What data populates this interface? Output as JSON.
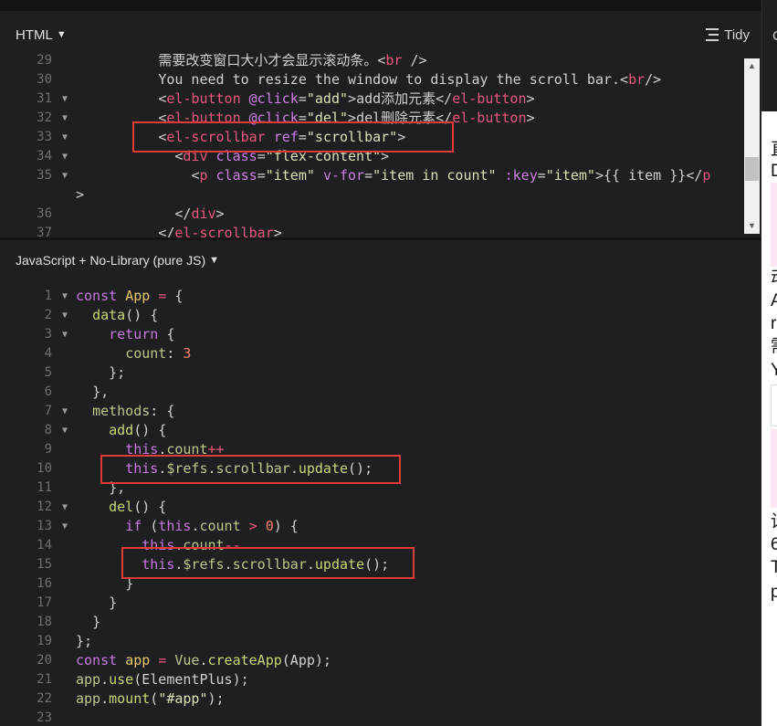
{
  "html_panel": {
    "lang_label": "HTML",
    "tidy_label": "Tidy",
    "lines": [
      {
        "n": "29",
        "fold": false,
        "indent": "          ",
        "tokens": [
          [
            "t",
            "需要改变窗口大小才会显示滚动条。"
          ],
          [
            "p",
            "<"
          ],
          [
            "tag",
            "br"
          ],
          [
            "p",
            " />"
          ]
        ]
      },
      {
        "n": "30",
        "fold": false,
        "indent": "          ",
        "tokens": [
          [
            "t",
            "You need to resize the window to display the scroll bar."
          ],
          [
            "p",
            "<"
          ],
          [
            "tag",
            "br"
          ],
          [
            "p",
            "/>"
          ]
        ]
      },
      {
        "n": "31",
        "fold": true,
        "indent": "          ",
        "tokens": [
          [
            "p",
            "<"
          ],
          [
            "tag",
            "el-button"
          ],
          [
            "t",
            " "
          ],
          [
            "attr",
            "@click"
          ],
          [
            "p",
            "="
          ],
          [
            "str",
            "\"add\""
          ],
          [
            "p",
            ">"
          ],
          [
            "t",
            "add添加元素"
          ],
          [
            "p",
            "</"
          ],
          [
            "tag",
            "el-button"
          ],
          [
            "p",
            ">"
          ]
        ]
      },
      {
        "n": "32",
        "fold": true,
        "indent": "          ",
        "tokens": [
          [
            "p",
            "<"
          ],
          [
            "tag",
            "el-button"
          ],
          [
            "t",
            " "
          ],
          [
            "attr",
            "@click"
          ],
          [
            "p",
            "="
          ],
          [
            "str",
            "\"del\""
          ],
          [
            "p",
            ">"
          ],
          [
            "t",
            "del删除元素"
          ],
          [
            "p",
            "</"
          ],
          [
            "tag",
            "el-button"
          ],
          [
            "p",
            ">"
          ]
        ]
      },
      {
        "n": "33",
        "fold": true,
        "indent": "          ",
        "tokens": [
          [
            "p",
            "<"
          ],
          [
            "tag",
            "el-scrollbar"
          ],
          [
            "t",
            " "
          ],
          [
            "attr",
            "ref"
          ],
          [
            "p",
            "="
          ],
          [
            "str",
            "\"scrollbar\""
          ],
          [
            "p",
            ">"
          ]
        ]
      },
      {
        "n": "34",
        "fold": true,
        "indent": "            ",
        "tokens": [
          [
            "p",
            "<"
          ],
          [
            "tag",
            "div"
          ],
          [
            "t",
            " "
          ],
          [
            "attr",
            "class"
          ],
          [
            "p",
            "="
          ],
          [
            "str",
            "\"flex-content\""
          ],
          [
            "p",
            ">"
          ]
        ]
      },
      {
        "n": "35",
        "fold": true,
        "indent": "              ",
        "tokens": [
          [
            "p",
            "<"
          ],
          [
            "tag",
            "p"
          ],
          [
            "t",
            " "
          ],
          [
            "attr",
            "class"
          ],
          [
            "p",
            "="
          ],
          [
            "str",
            "\"item\""
          ],
          [
            "t",
            " "
          ],
          [
            "attr",
            "v-for"
          ],
          [
            "p",
            "="
          ],
          [
            "str",
            "\"item in count\""
          ],
          [
            "t",
            " "
          ],
          [
            "attr",
            ":key"
          ],
          [
            "p",
            "="
          ],
          [
            "str",
            "\"item\""
          ],
          [
            "p",
            ">"
          ],
          [
            "t",
            "{{ item }}"
          ],
          [
            "p",
            "</"
          ],
          [
            "tag",
            "p"
          ]
        ]
      },
      {
        "n": "",
        "fold": false,
        "indent": "",
        "tokens": [
          [
            "p",
            ">"
          ]
        ]
      },
      {
        "n": "36",
        "fold": false,
        "indent": "            ",
        "tokens": [
          [
            "p",
            "</"
          ],
          [
            "tag",
            "div"
          ],
          [
            "p",
            ">"
          ]
        ]
      },
      {
        "n": "37",
        "fold": false,
        "indent": "          ",
        "tokens": [
          [
            "p",
            "</"
          ],
          [
            "tag",
            "el-scrollbar"
          ],
          [
            "p",
            ">"
          ]
        ]
      }
    ]
  },
  "js_panel": {
    "lang_label": "JavaScript + No-Library (pure JS)",
    "lines": [
      {
        "n": "1",
        "fold": true,
        "indent": "",
        "tokens": [
          [
            "kw",
            "const"
          ],
          [
            "t",
            " "
          ],
          [
            "var",
            "App"
          ],
          [
            "t",
            " "
          ],
          [
            "tag",
            "="
          ],
          [
            "t",
            " {"
          ]
        ]
      },
      {
        "n": "2",
        "fold": true,
        "indent": "  ",
        "tokens": [
          [
            "fn",
            "data"
          ],
          [
            "t",
            "() {"
          ]
        ]
      },
      {
        "n": "3",
        "fold": true,
        "indent": "    ",
        "tokens": [
          [
            "kw",
            "return"
          ],
          [
            "t",
            " {"
          ]
        ]
      },
      {
        "n": "4",
        "fold": false,
        "indent": "      ",
        "tokens": [
          [
            "prop",
            "count"
          ],
          [
            "t",
            ": "
          ],
          [
            "num",
            "3"
          ]
        ]
      },
      {
        "n": "5",
        "fold": false,
        "indent": "    ",
        "tokens": [
          [
            "t",
            "};"
          ]
        ]
      },
      {
        "n": "6",
        "fold": false,
        "indent": "  ",
        "tokens": [
          [
            "t",
            "},"
          ]
        ]
      },
      {
        "n": "7",
        "fold": true,
        "indent": "  ",
        "tokens": [
          [
            "prop",
            "methods"
          ],
          [
            "t",
            ": {"
          ]
        ]
      },
      {
        "n": "8",
        "fold": true,
        "indent": "    ",
        "tokens": [
          [
            "fn",
            "add"
          ],
          [
            "t",
            "() {"
          ]
        ]
      },
      {
        "n": "9",
        "fold": false,
        "indent": "      ",
        "tokens": [
          [
            "kw",
            "this"
          ],
          [
            "t",
            "."
          ],
          [
            "prop",
            "count"
          ],
          [
            "tag",
            "++"
          ]
        ]
      },
      {
        "n": "10",
        "fold": false,
        "indent": "      ",
        "tokens": [
          [
            "kw",
            "this"
          ],
          [
            "t",
            "."
          ],
          [
            "prop",
            "$refs"
          ],
          [
            "t",
            "."
          ],
          [
            "prop",
            "scrollbar"
          ],
          [
            "t",
            "."
          ],
          [
            "fn",
            "update"
          ],
          [
            "t",
            "();"
          ]
        ]
      },
      {
        "n": "11",
        "fold": false,
        "indent": "    ",
        "tokens": [
          [
            "t",
            "},"
          ]
        ]
      },
      {
        "n": "12",
        "fold": true,
        "indent": "    ",
        "tokens": [
          [
            "fn",
            "del"
          ],
          [
            "t",
            "() {"
          ]
        ]
      },
      {
        "n": "13",
        "fold": true,
        "indent": "      ",
        "tokens": [
          [
            "kw",
            "if"
          ],
          [
            "t",
            " ("
          ],
          [
            "kw",
            "this"
          ],
          [
            "t",
            "."
          ],
          [
            "prop",
            "count"
          ],
          [
            "t",
            " "
          ],
          [
            "tag",
            ">"
          ],
          [
            "t",
            " "
          ],
          [
            "num",
            "0"
          ],
          [
            "t",
            ") {"
          ]
        ]
      },
      {
        "n": "14",
        "fold": false,
        "indent": "        ",
        "tokens": [
          [
            "kw",
            "this"
          ],
          [
            "t",
            "."
          ],
          [
            "prop",
            "count"
          ],
          [
            "tag",
            "--"
          ]
        ]
      },
      {
        "n": "15",
        "fold": false,
        "indent": "        ",
        "tokens": [
          [
            "kw",
            "this"
          ],
          [
            "t",
            "."
          ],
          [
            "prop",
            "$refs"
          ],
          [
            "t",
            "."
          ],
          [
            "prop",
            "scrollbar"
          ],
          [
            "t",
            "."
          ],
          [
            "fn",
            "update"
          ],
          [
            "t",
            "();"
          ]
        ]
      },
      {
        "n": "16",
        "fold": false,
        "indent": "      ",
        "tokens": [
          [
            "t",
            "}"
          ]
        ]
      },
      {
        "n": "17",
        "fold": false,
        "indent": "    ",
        "tokens": [
          [
            "t",
            "}"
          ]
        ]
      },
      {
        "n": "18",
        "fold": false,
        "indent": "  ",
        "tokens": [
          [
            "t",
            "}"
          ]
        ]
      },
      {
        "n": "19",
        "fold": false,
        "indent": "",
        "tokens": [
          [
            "t",
            "};"
          ]
        ]
      },
      {
        "n": "20",
        "fold": false,
        "indent": "",
        "tokens": [
          [
            "kw",
            "const"
          ],
          [
            "t",
            " "
          ],
          [
            "var",
            "app"
          ],
          [
            "t",
            " "
          ],
          [
            "tag",
            "="
          ],
          [
            "t",
            " "
          ],
          [
            "prop",
            "Vue"
          ],
          [
            "t",
            "."
          ],
          [
            "fn",
            "createApp"
          ],
          [
            "t",
            "(App);"
          ]
        ]
      },
      {
        "n": "21",
        "fold": false,
        "indent": "",
        "tokens": [
          [
            "prop",
            "app"
          ],
          [
            "t",
            "."
          ],
          [
            "fn",
            "use"
          ],
          [
            "t",
            "(ElementPlus);"
          ]
        ]
      },
      {
        "n": "22",
        "fold": false,
        "indent": "",
        "tokens": [
          [
            "prop",
            "app"
          ],
          [
            "t",
            "."
          ],
          [
            "fn",
            "mount"
          ],
          [
            "t",
            "("
          ],
          [
            "str",
            "\"#app\""
          ],
          [
            "t",
            ");"
          ]
        ]
      },
      {
        "n": "23",
        "fold": false,
        "indent": "",
        "tokens": []
      }
    ]
  },
  "result_panel": {
    "header_char": "C",
    "visible_chars": [
      "直",
      "D",
      "动",
      "A",
      "r",
      "需",
      "Y",
      "设",
      "6",
      "T",
      "p"
    ]
  },
  "colors": {
    "background": "#1d1f21",
    "highlight_box": "#e03b3b",
    "tag": "#e9577c",
    "attribute": "#cd7fe3",
    "string": "#d8e3b5",
    "keyword": "#c778dd",
    "function": "#c2d974",
    "variable": "#e7c56b",
    "number": "#f0846a"
  },
  "icons": [
    "dropdown-triangle-icon",
    "tidy-lines-icon",
    "fold-arrow-icon",
    "scroll-up-arrow-icon",
    "scroll-down-arrow-icon"
  ]
}
